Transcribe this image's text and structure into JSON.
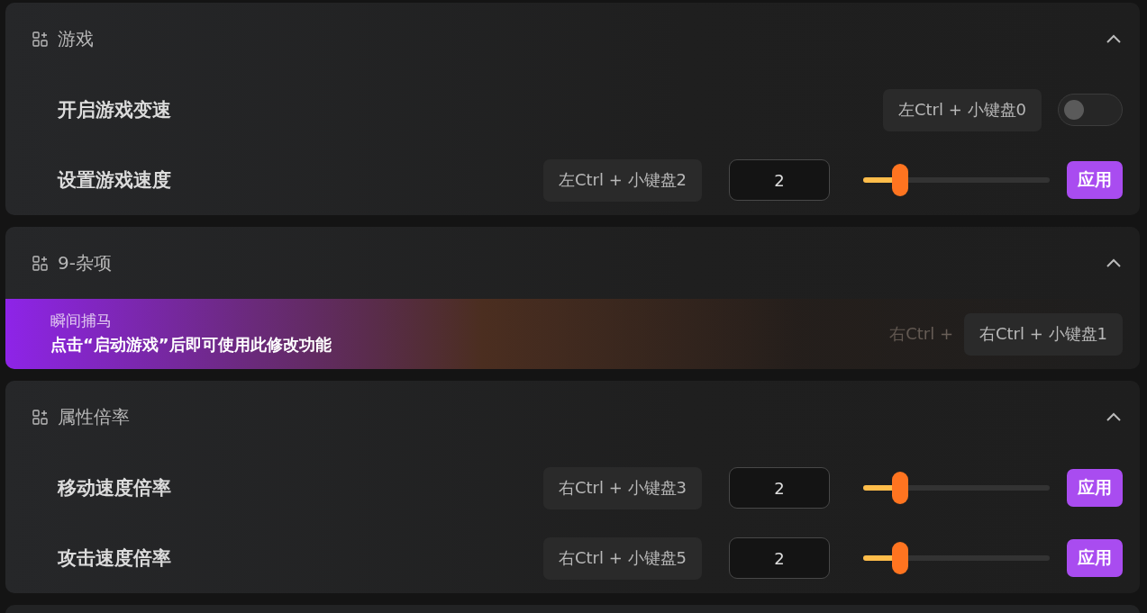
{
  "sections": [
    {
      "title": "游戏",
      "expanded": true,
      "rows": [
        {
          "kind": "toggle",
          "label": "开启游戏变速",
          "shortcut": "左Ctrl + 小键盘0",
          "on": false
        },
        {
          "kind": "slider",
          "label": "设置游戏速度",
          "shortcut": "左Ctrl + 小键盘2",
          "value": "2",
          "level": 0.2,
          "button": "应用"
        }
      ]
    },
    {
      "title": "9-杂项",
      "expanded": true,
      "rows": [
        {
          "kind": "covered",
          "faded_text": "右Ctrl +",
          "shortcut": "右Ctrl + 小键盘1"
        }
      ],
      "toast": {
        "title": "瞬间捕马",
        "message": "点击“启动游戏”后即可使用此修改功能"
      }
    },
    {
      "title": "属性倍率",
      "expanded": true,
      "rows": [
        {
          "kind": "slider",
          "label": "移动速度倍率",
          "shortcut": "右Ctrl + 小键盘3",
          "value": "2",
          "level": 0.2,
          "button": "应用"
        },
        {
          "kind": "slider",
          "label": "攻击速度倍率",
          "shortcut": "右Ctrl + 小键盘5",
          "value": "2",
          "level": 0.2,
          "button": "应用"
        }
      ]
    }
  ]
}
